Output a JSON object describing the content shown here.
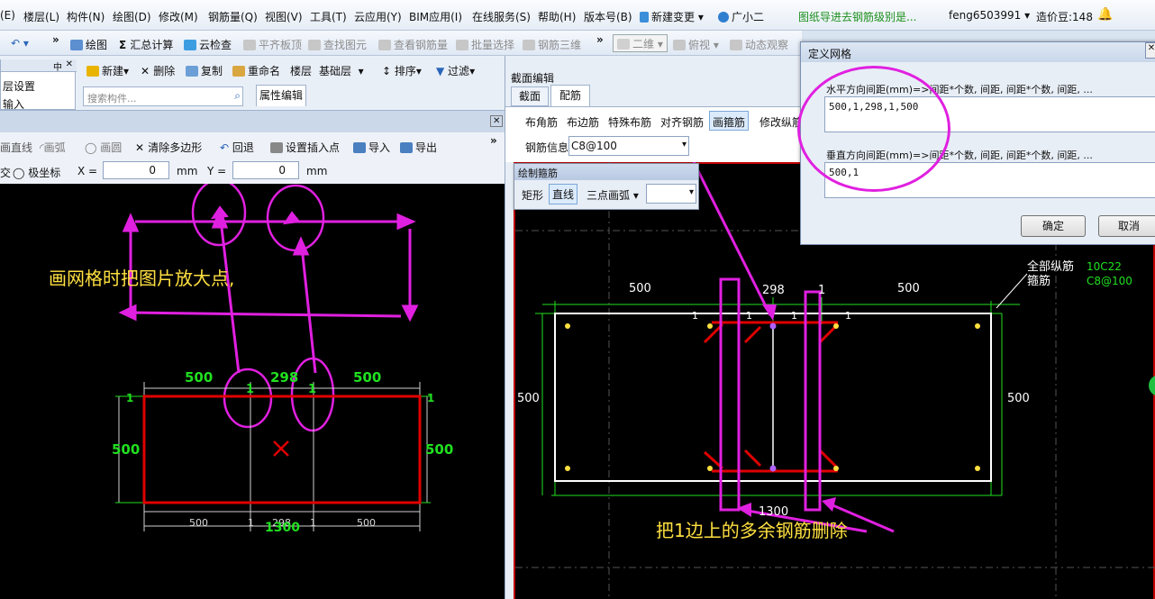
{
  "menubar": {
    "items": [
      "(E)",
      "楼层(L)",
      "构件(N)",
      "绘图(D)",
      "修改(M)",
      "钢筋量(Q)",
      "视图(V)",
      "工具(T)",
      "云应用(Y)",
      "BIM应用(I)",
      "在线服务(S)",
      "帮助(H)",
      "版本号(B)",
      "新建变更",
      "广小二"
    ],
    "notice": "图纸导进去钢筋级别是...",
    "user": "feng6503991",
    "cost_label": "造价豆:148"
  },
  "toolbar": {
    "items": [
      "绘图",
      "汇总计算",
      "云检查",
      "平齐板顶",
      "查找图元",
      "查看钢筋量",
      "批量选择",
      "钢筋三维",
      "二维",
      "俯视",
      "动态观察"
    ]
  },
  "left": {
    "tree_items": [
      "层设置",
      "输入"
    ],
    "component_toolbar": [
      "新建",
      "删除",
      "复制",
      "重命名",
      "楼层",
      "基础层",
      "排序",
      "过滤"
    ],
    "search_placeholder": "搜索构件...",
    "tab_attr": "属性编辑",
    "draw_toolbar": [
      "画直线",
      "画弧",
      "画圆",
      "清除多边形",
      "回退",
      "设置插入点",
      "导入",
      "导出"
    ],
    "coord": {
      "polar_label": "极坐标",
      "x_label": "X =",
      "x_value": "0",
      "y_label": "Y =",
      "y_value": "0",
      "unit": "mm",
      "intersect_label": "交"
    },
    "annotation": "画网格时把图片放大点,",
    "dims_top": [
      "500",
      "298",
      "500"
    ],
    "dims_mid": [
      "1",
      "1"
    ],
    "dims_side": [
      "500",
      "500"
    ],
    "dims_bottom": [
      "500",
      "1",
      "298",
      "1",
      "500"
    ],
    "dims_total": "1300",
    "dims_corner": [
      "1",
      "1"
    ]
  },
  "right": {
    "panel_title": "截面编辑",
    "tabs": [
      "截面",
      "配筋"
    ],
    "rebar_toolbar": [
      "布角筋",
      "布边筋",
      "特殊布筋",
      "对齐钢筋",
      "画箍筋",
      "修改纵筋"
    ],
    "rebar_info_label": "钢筋信息",
    "rebar_info_value": "C8@100",
    "stirrup_panel_title": "绘制箍筋",
    "stirrup_tools": [
      "矩形",
      "直线",
      "三点画弧"
    ],
    "legend_long": "全部纵筋",
    "legend_long_value": "10C22",
    "legend_stirrup": "箍筋",
    "legend_stirrup_value": "C8@100",
    "dims_top": [
      "500",
      "298",
      "1",
      "500"
    ],
    "dims_ones": [
      "1",
      "1",
      "1",
      "1"
    ],
    "dims_side": [
      "500",
      "500"
    ],
    "dims_bottom": "1300",
    "annotation": "把1边上的多余钢筋删除"
  },
  "dialog": {
    "title": "定义网格",
    "h_label": "水平方向间距(mm)=>间距*个数, 间距, 间距*个数, 间距, ...",
    "h_value": "500,1,298,1,500",
    "v_label": "垂直方向间距(mm)=>间距*个数, 间距, 间距*个数, 间距, ...",
    "v_value": "500,1",
    "ok": "确定",
    "cancel": "取消"
  },
  "colors": {
    "cad_bg": "#000000",
    "outline_red": "#e00000",
    "dim_green": "#20e020",
    "annot_magenta": "#e020e0",
    "annot_yellow": "#ffe040"
  }
}
